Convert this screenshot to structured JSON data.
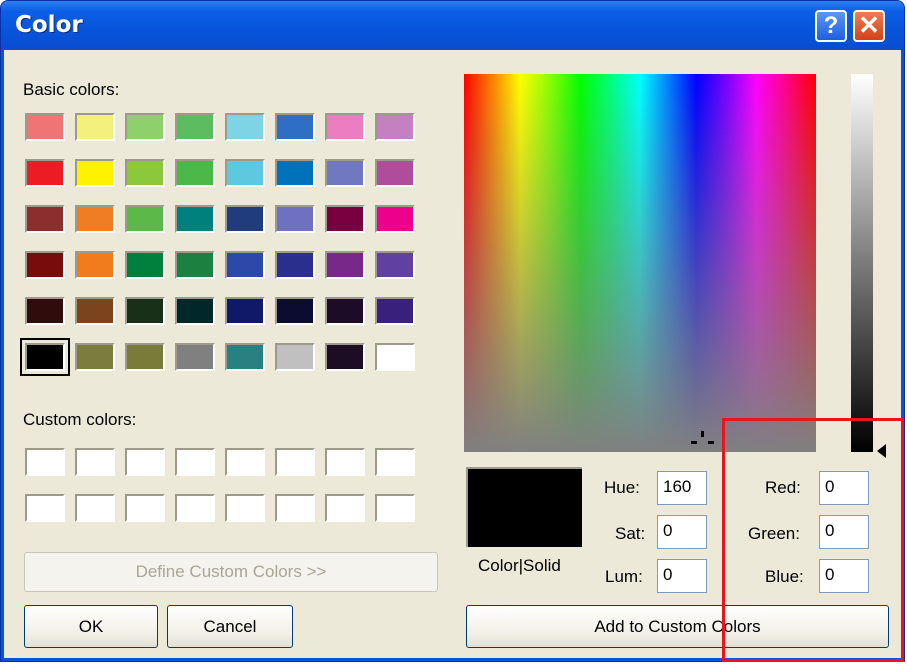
{
  "window": {
    "title": "Color",
    "help_label": "?",
    "close_label": "✕"
  },
  "basic_colors_label": "Basic colors:",
  "basic_colors": [
    [
      "#f07474",
      "#f4f07c",
      "#8ed06c",
      "#5cbc60",
      "#7ed4e4",
      "#2e6ec4",
      "#ea7ec0",
      "#c480c0"
    ],
    [
      "#ec1c24",
      "#fff200",
      "#8cc83c",
      "#4cb848",
      "#5ec8e0",
      "#0072bc",
      "#7078c0",
      "#b04c9c"
    ],
    [
      "#8c2e2e",
      "#f07c24",
      "#5cb848",
      "#00807c",
      "#203c7c",
      "#7070c0",
      "#780040",
      "#ec008c"
    ],
    [
      "#780c0c",
      "#f07c1c",
      "#00803c",
      "#1c8040",
      "#2c48a8",
      "#2a2e8c",
      "#782888",
      "#6040a0"
    ],
    [
      "#300c0c",
      "#7c441c",
      "#183018",
      "#002828",
      "#101868",
      "#0c0c30",
      "#1c0c28",
      "#38207c"
    ],
    [
      "#000000",
      "#7c7c3c",
      "#787c38",
      "#808080",
      "#288080",
      "#c0c0c0",
      "#1c0c24",
      "#ffffff"
    ]
  ],
  "custom_colors_label": "Custom colors:",
  "define_custom_label": "Define Custom Colors >>",
  "ok_label": "OK",
  "cancel_label": "Cancel",
  "color_solid_label": "Color|Solid",
  "hsl": [
    {
      "label": "Hue:",
      "value": "160"
    },
    {
      "label": "Sat:",
      "value": "0"
    },
    {
      "label": "Lum:",
      "value": "0"
    }
  ],
  "rgb": [
    {
      "label": "Red:",
      "value": "0"
    },
    {
      "label": "Green:",
      "value": "0"
    },
    {
      "label": "Blue:",
      "value": "0"
    }
  ],
  "add_custom_label": "Add to Custom Colors",
  "selected_color": "#000000",
  "highlight_color": "#e8141e"
}
